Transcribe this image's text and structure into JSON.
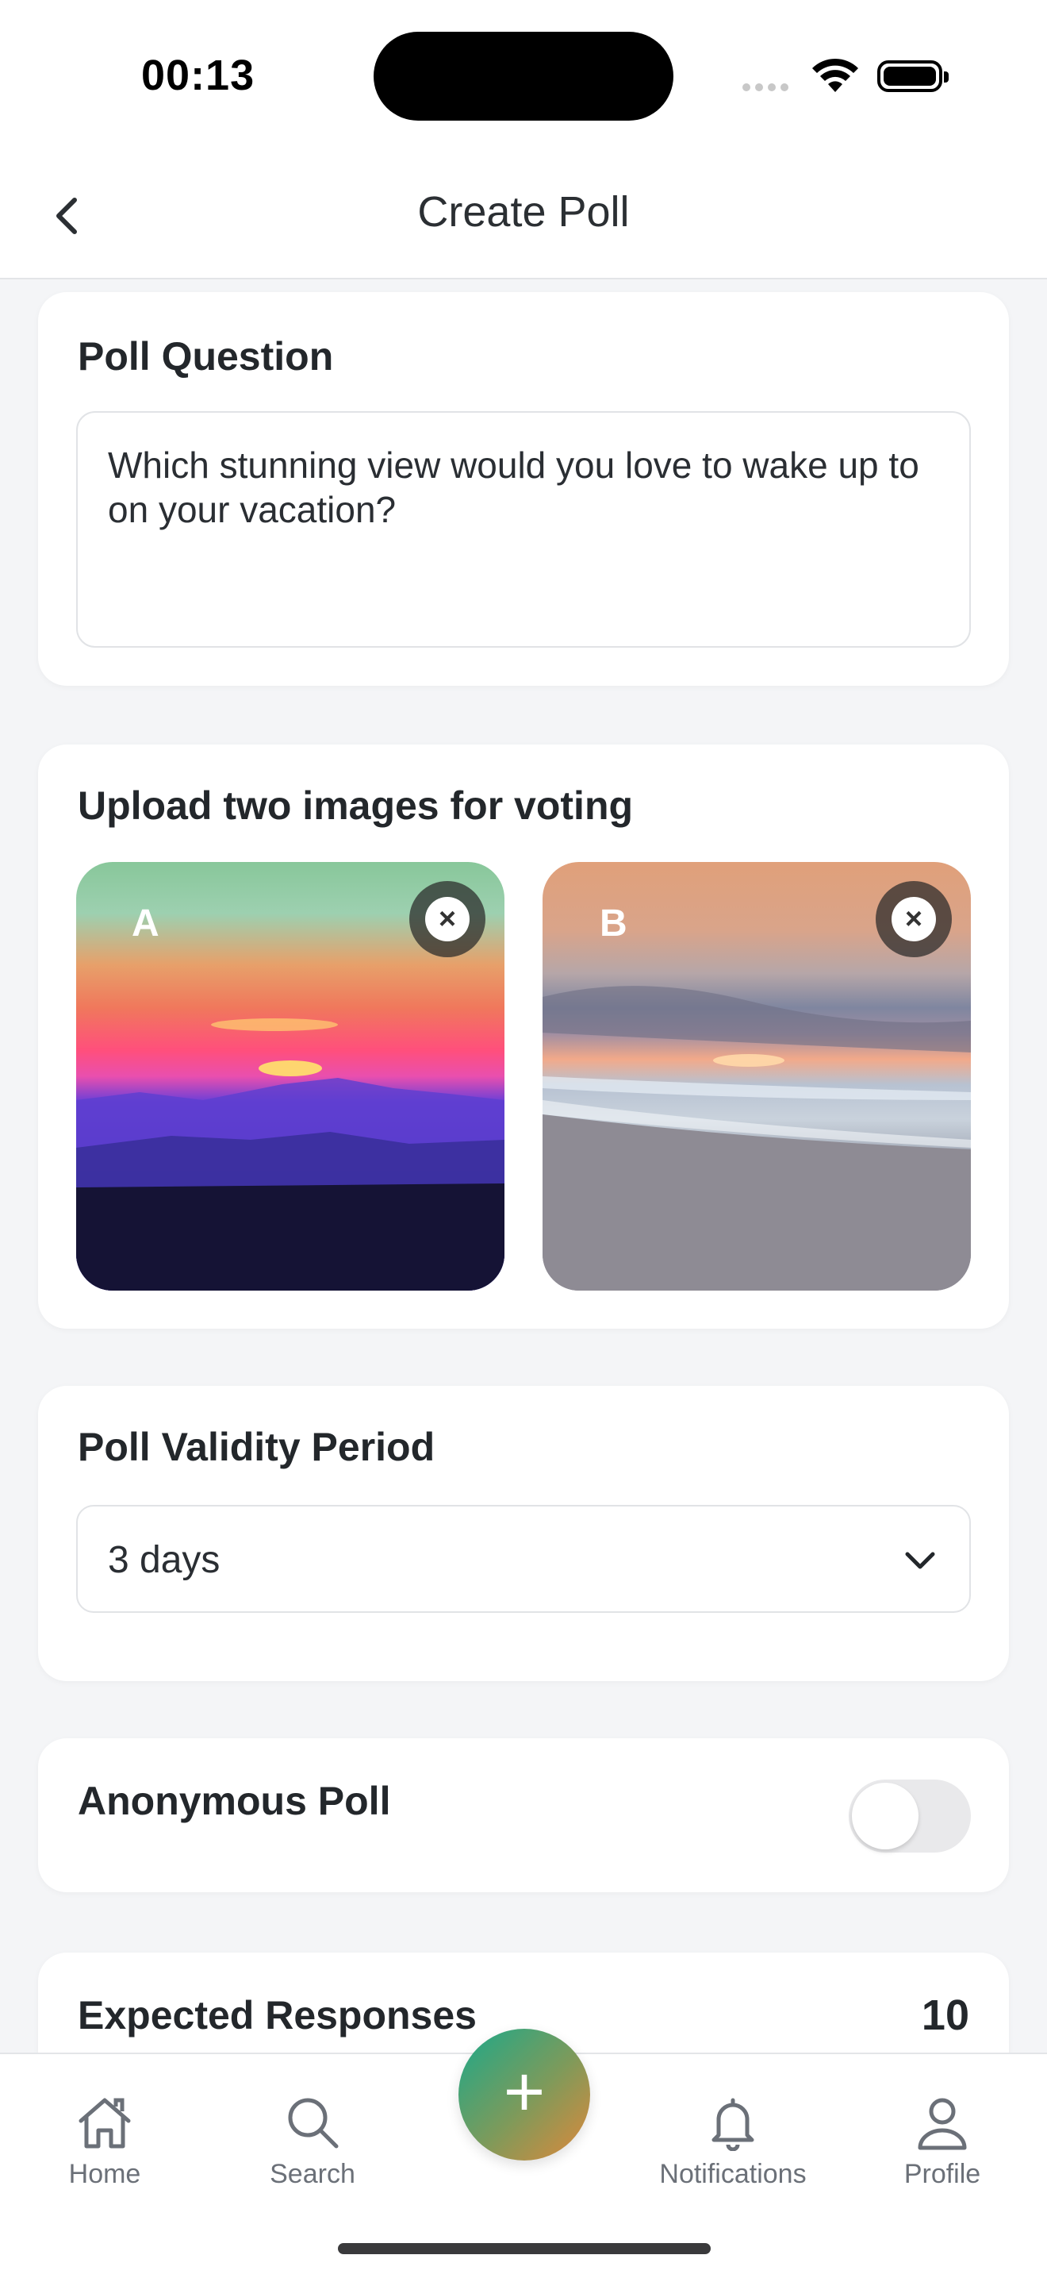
{
  "status_bar": {
    "time": "00:13"
  },
  "header": {
    "title": "Create Poll"
  },
  "question_card": {
    "title": "Poll Question",
    "question_text": "Which stunning view would you love to wake up to on your vacation?"
  },
  "images_card": {
    "title": "Upload two images for voting",
    "images": [
      {
        "letter": "A",
        "remove_icon": "×"
      },
      {
        "letter": "B",
        "remove_icon": "×"
      }
    ]
  },
  "validity_card": {
    "title": "Poll Validity Period",
    "selected": "3 days"
  },
  "anonymous_card": {
    "title": "Anonymous Poll",
    "enabled": false
  },
  "responses_card": {
    "title": "Expected Responses",
    "value": "10"
  },
  "tabbar": {
    "home": "Home",
    "search": "Search",
    "fab_icon": "+",
    "notifications": "Notifications",
    "profile": "Profile"
  },
  "colors": {
    "background": "#f4f5f7",
    "card": "#ffffff",
    "fab_gradient_start": "#1aa98a",
    "fab_gradient_end": "#e0883a"
  }
}
